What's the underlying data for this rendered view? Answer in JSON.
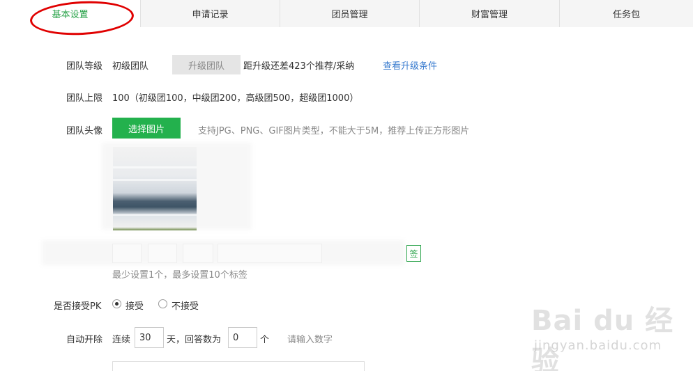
{
  "tabs": [
    {
      "label": "基本设置",
      "active": true
    },
    {
      "label": "申请记录",
      "active": false
    },
    {
      "label": "团员管理",
      "active": false
    },
    {
      "label": "财富管理",
      "active": false
    },
    {
      "label": "任务包",
      "active": false
    }
  ],
  "level": {
    "label": "团队等级",
    "value": "初级团队",
    "upgrade_button": "升级团队",
    "progress_text": "距升级还差423个推荐/采纳",
    "view_link": "查看升级条件"
  },
  "limit": {
    "label": "团队上限",
    "value": "100（初级团100，中级团200，高级团500，超级团1000）"
  },
  "avatar": {
    "label": "团队头像",
    "choose_button": "选择图片",
    "hint": "支持JPG、PNG、GIF图片类型，不能大于5M，推荐上传正方形图片"
  },
  "tags": {
    "add_button_partial": "签",
    "hint": "最少设置1个，最多设置10个标签"
  },
  "pk": {
    "label": "是否接受PK",
    "accept": "接受",
    "reject": "不接受",
    "selected": "接受"
  },
  "auto_open": {
    "label": "自动开除",
    "prefix": "连续",
    "days_value": "30",
    "days_unit": "天，回答数为",
    "answers_value": "0",
    "answers_unit": "个",
    "hint": "请输入数字"
  },
  "watermark": {
    "logo": "Bai du 经验",
    "url": "jingyan.baidu.com"
  },
  "colors": {
    "accent_green": "#23b14d",
    "link_blue": "#3a7ccf",
    "annotation_red": "#e00000"
  }
}
